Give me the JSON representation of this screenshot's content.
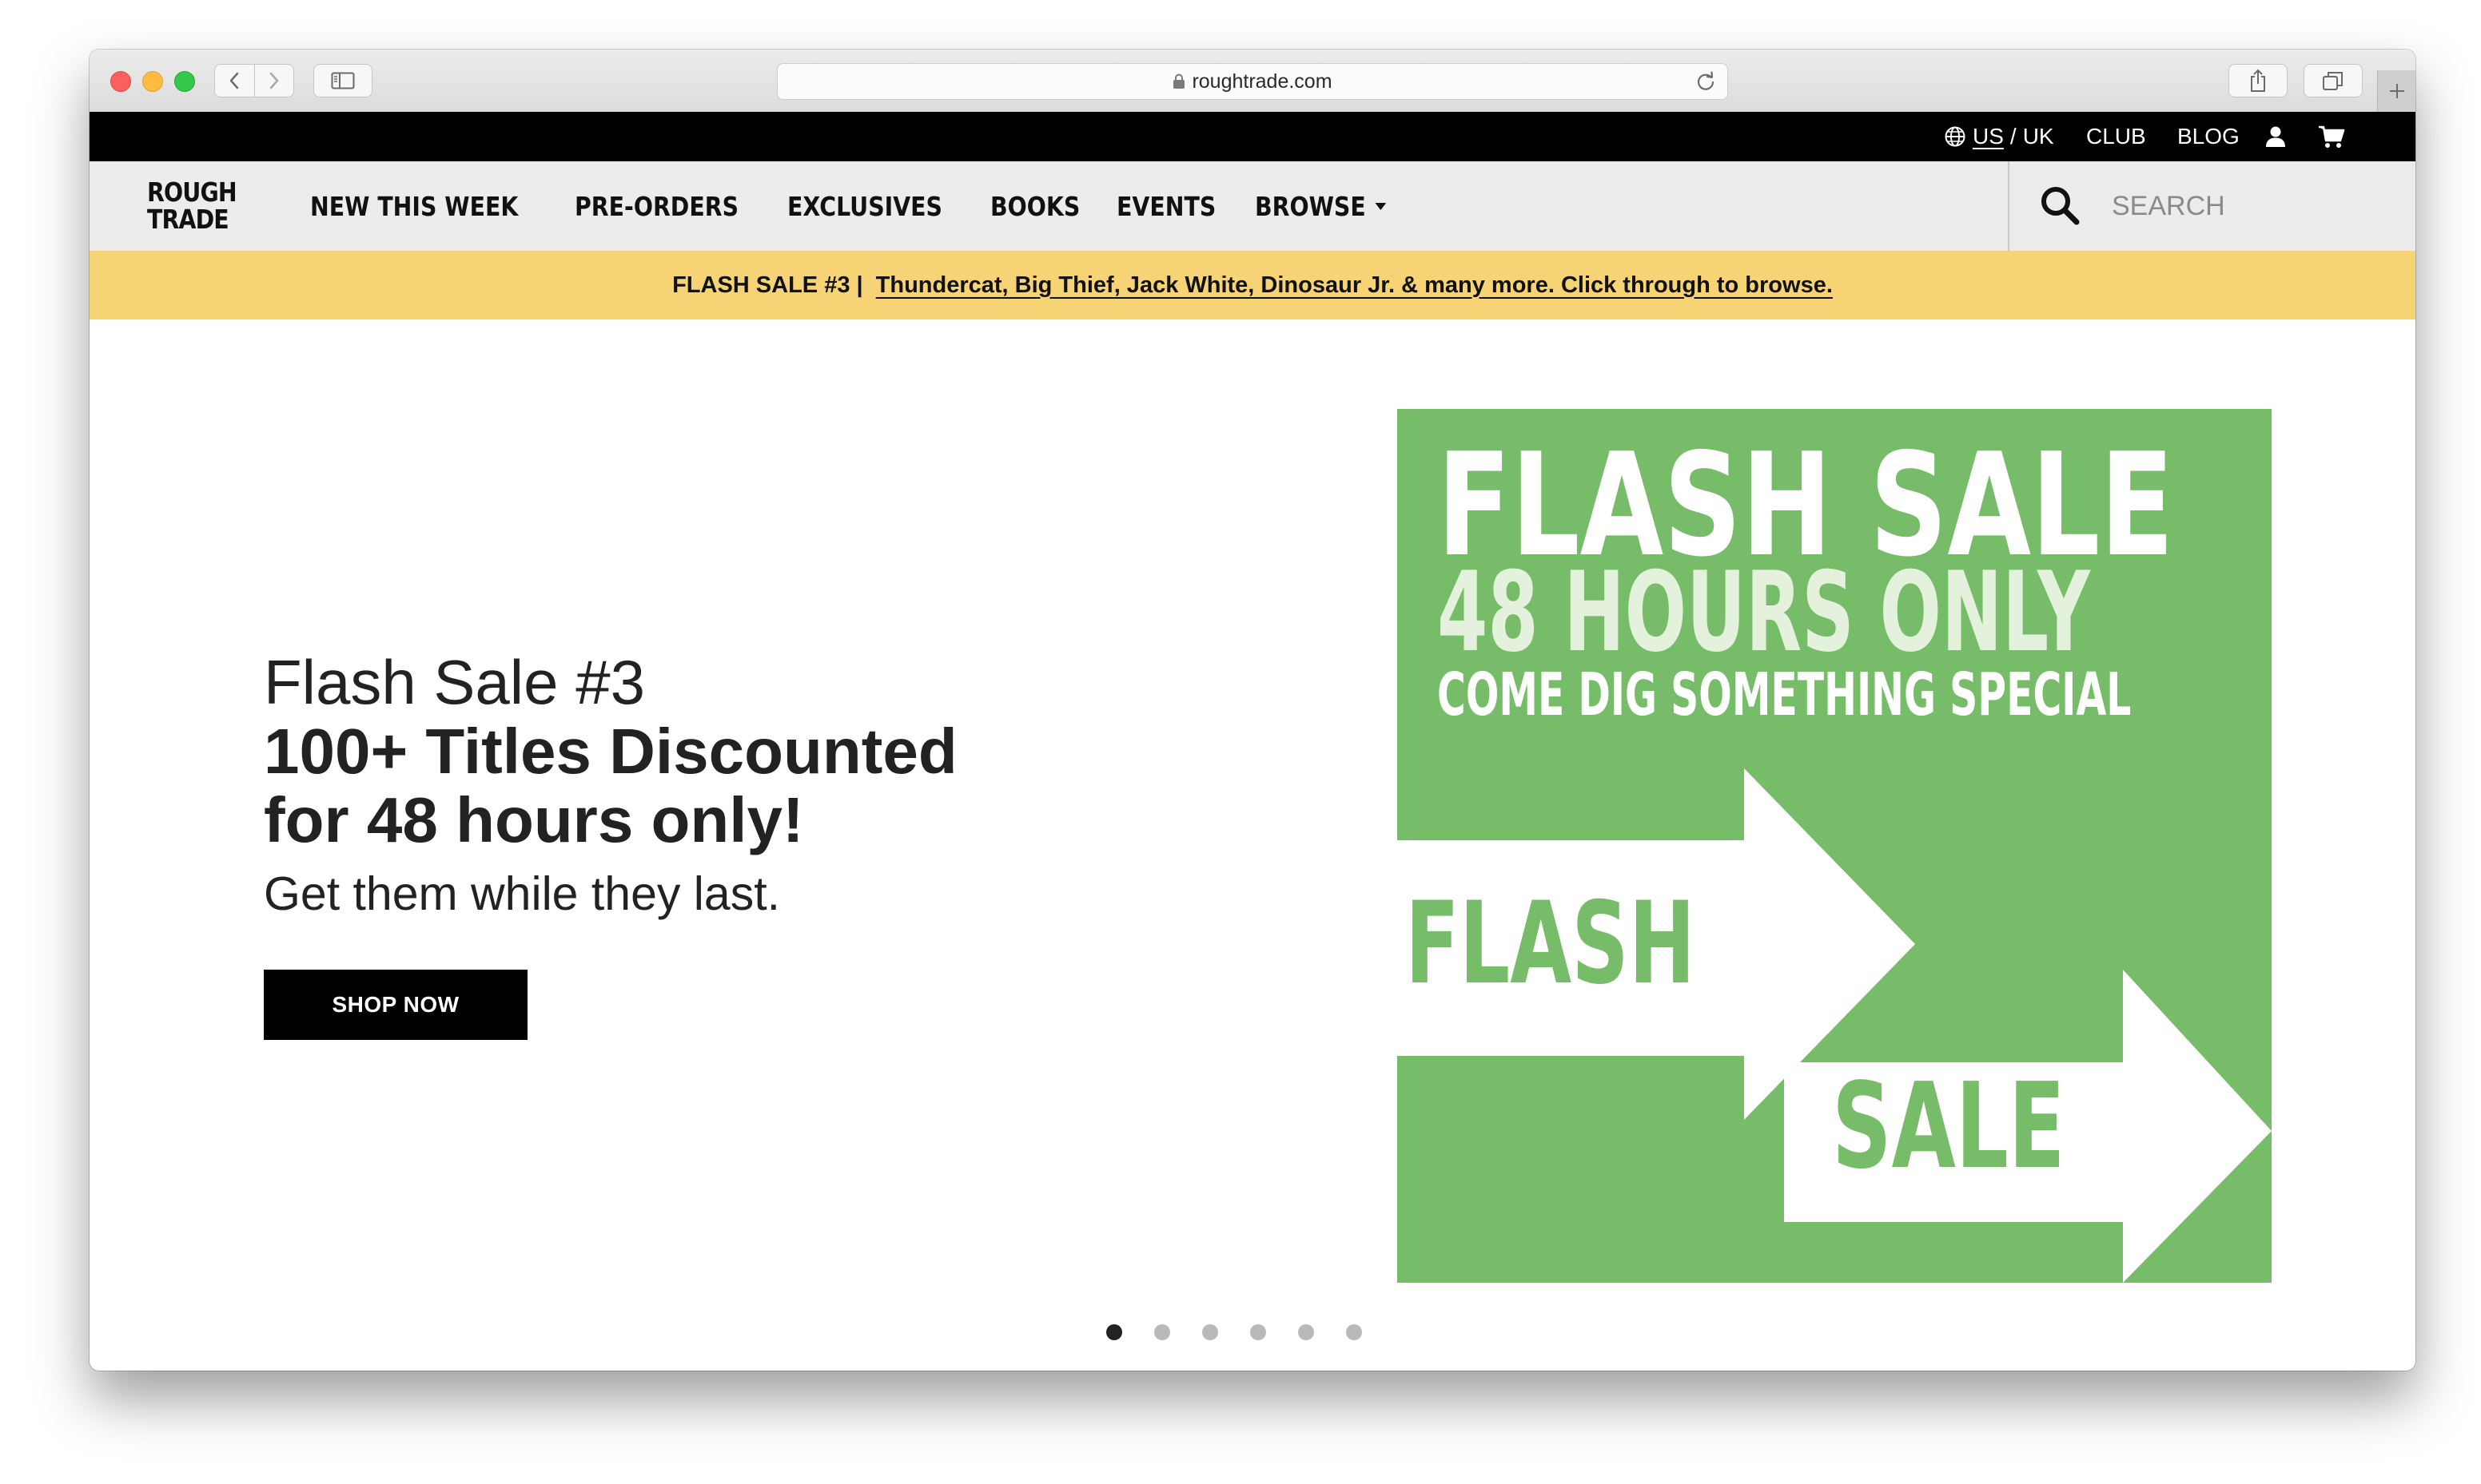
{
  "browser": {
    "url": "roughtrade.com",
    "icons": [
      "back-icon",
      "forward-icon",
      "sidebar-icon",
      "lock-icon",
      "reload-icon",
      "share-icon",
      "tabs-icon",
      "plus-icon"
    ]
  },
  "utility_bar": {
    "region_us": "US",
    "region_sep": "/",
    "region_uk": "UK",
    "club": "CLUB",
    "blog": "BLOG",
    "icons": [
      "globe-icon",
      "account-icon",
      "cart-icon"
    ]
  },
  "nav": {
    "logo_line1": "ROUGH",
    "logo_line2": "TRADE",
    "links": [
      "NEW THIS WEEK",
      "PRE-ORDERS",
      "EXCLUSIVES",
      "BOOKS",
      "EVENTS",
      "BROWSE"
    ],
    "search_placeholder": "SEARCH"
  },
  "announcement": {
    "label": "FLASH SALE #3 |",
    "link_text": "Thundercat, Big Thief, Jack White, Dinosaur Jr. & many more. Click through to browse."
  },
  "hero": {
    "title": "Flash Sale #3",
    "headline_line1": "100+ Titles Discounted",
    "headline_line2": "for 48 hours only!",
    "subtitle": "Get them while they last.",
    "cta": "SHOP NOW"
  },
  "promo_image": {
    "line1": "FLASH SALE",
    "line2": "48 HOURS ONLY",
    "line3": "COME DIG SOMETHING SPECIAL",
    "arrow1_text": "FLASH",
    "arrow2_text": "SALE",
    "background_color": "#77bd69"
  },
  "carousel": {
    "slide_count": 6,
    "active_slide": 1
  },
  "colors": {
    "announcement_bg": "#f6d375",
    "utility_bar_bg": "#000000",
    "nav_bg": "#ececec",
    "cta_bg": "#000000"
  }
}
